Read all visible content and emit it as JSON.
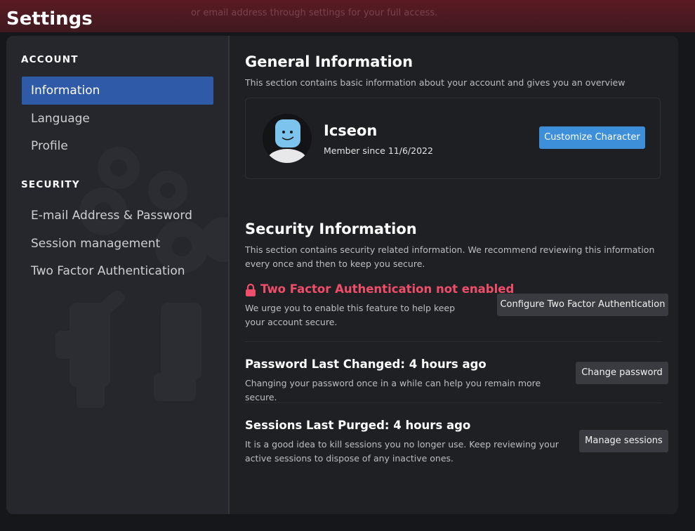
{
  "banner": {
    "line1": "",
    "line2": "or email address through settings for your full access."
  },
  "page_title": "Settings",
  "sidebar": {
    "account_heading": "ACCOUNT",
    "account_items": [
      {
        "label": "Information",
        "active": true
      },
      {
        "label": "Language",
        "active": false
      },
      {
        "label": "Profile",
        "active": false
      }
    ],
    "security_heading": "SECURITY",
    "security_items": [
      {
        "label": "E-mail Address & Password"
      },
      {
        "label": "Session management"
      },
      {
        "label": "Two Factor Authentication"
      }
    ]
  },
  "general": {
    "title": "General Information",
    "description": "This section contains basic information about your account and gives you an overview",
    "username": "Icseon",
    "member_since": "Member since 11/6/2022",
    "customize_button": "Customize Character"
  },
  "security": {
    "title": "Security Information",
    "description": "This section contains security related information. We recommend reviewing this information every once and then to keep you secure.",
    "two_factor": {
      "title": "Two Factor Authentication not enabled",
      "description": "We urge you to enable this feature to help keep your account secure.",
      "button": "Configure Two Factor Authentication",
      "icon": "lock-icon"
    },
    "password": {
      "title": "Password Last Changed: 4 hours ago",
      "description": "Changing your password once in a while can help you remain more secure.",
      "button": "Change password"
    },
    "sessions": {
      "title": "Sessions Last Purged: 4 hours ago",
      "description": "It is a good idea to kill sessions you no longer use. Keep reviewing your active sessions to dispose of any inactive ones.",
      "button": "Manage sessions"
    }
  },
  "colors": {
    "accent": "#2f5aa8",
    "primary_button": "#3d8fd9",
    "alert": "#ef4e6a"
  }
}
